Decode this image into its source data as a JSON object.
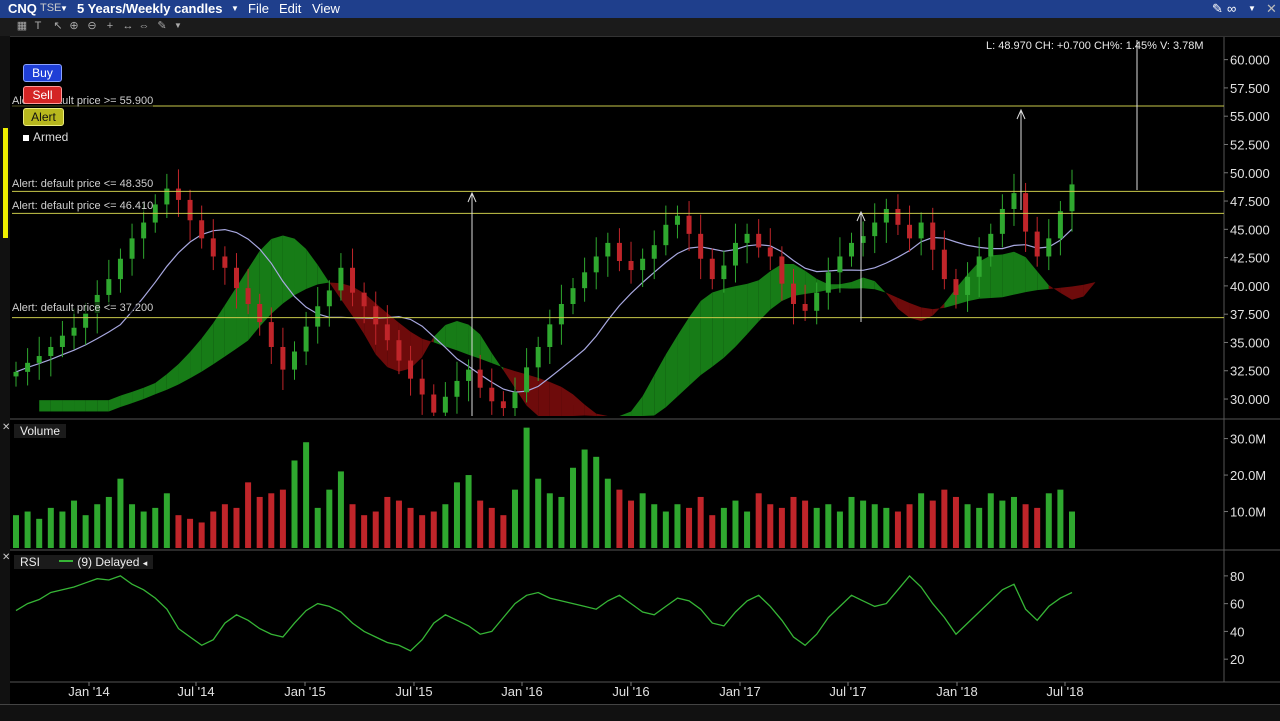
{
  "header": {
    "symbol": "CNQ",
    "exchange": "TSE",
    "period": "5 Years/Weekly candles",
    "menu": [
      "File",
      "Edit",
      "View"
    ]
  },
  "quote_readout": "L: 48.970 CH: +0.700 CH%: 1.45% V: 3.78M",
  "buttons": {
    "buy": "Buy",
    "sell": "Sell",
    "alert": "Alert",
    "armed": "Armed"
  },
  "alerts": [
    {
      "label": "Alert: default price >= 55.900",
      "price": 55.9
    },
    {
      "label": "Alert: default price <= 48.350",
      "price": 48.35
    },
    {
      "label": "Alert: default price <= 46.410",
      "price": 46.41
    },
    {
      "label": "Alert: default price <= 37.200",
      "price": 37.2
    }
  ],
  "colors": {
    "up": "#2fa82f",
    "down": "#c0252a",
    "cloud_bull": "#1a8a1a",
    "cloud_bear": "#7a0c0c",
    "ma": "#a8a8e0",
    "rsi": "#36b536",
    "alert_line": "#c8c84a",
    "title_bar": "#1f3f8c"
  },
  "panels": {
    "volume_title": "Volume",
    "rsi_title": "RSI",
    "rsi_legend": "(9) Delayed"
  },
  "chart_data": [
    {
      "type": "candlestick",
      "title": "CNQ TSE 5 Years/Weekly candles",
      "ylim": [
        28.5,
        62
      ],
      "y_ticks": [
        "60.000",
        "57.500",
        "55.000",
        "52.500",
        "50.000",
        "47.500",
        "45.000",
        "42.500",
        "40.000",
        "37.500",
        "35.000",
        "32.500",
        "30.000"
      ],
      "x_ticks": [
        "Jan '14",
        "Jul '14",
        "Jan '15",
        "Jul '15",
        "Jan '16",
        "Jul '16",
        "Jan '17",
        "Jul '17",
        "Jan '18",
        "Jul '18"
      ],
      "close_series": [
        32.4,
        33.2,
        33.8,
        34.6,
        35.6,
        36.3,
        37.6,
        39.2,
        40.6,
        42.4,
        44.2,
        45.6,
        47.2,
        48.6,
        47.6,
        45.8,
        44.2,
        42.6,
        41.6,
        39.8,
        38.4,
        36.8,
        34.6,
        32.6,
        34.2,
        36.4,
        38.2,
        39.6,
        41.6,
        39.4,
        38.2,
        36.6,
        35.2,
        33.4,
        31.8,
        30.4,
        28.8,
        30.2,
        31.6,
        32.6,
        31.0,
        29.8,
        29.2,
        30.6,
        32.8,
        34.6,
        36.6,
        38.4,
        39.8,
        41.2,
        42.6,
        43.8,
        42.2,
        41.4,
        42.4,
        43.6,
        45.4,
        46.2,
        44.6,
        42.4,
        40.6,
        41.8,
        43.8,
        44.6,
        43.4,
        42.6,
        40.2,
        38.4,
        37.8,
        39.4,
        41.2,
        42.6,
        43.8,
        44.4,
        45.6,
        46.8,
        45.4,
        44.2,
        45.6,
        43.2,
        40.6,
        39.2,
        40.8,
        42.6,
        44.6,
        46.8,
        48.2,
        44.8,
        42.6,
        44.2,
        46.6,
        48.97
      ],
      "alert_levels": [
        55.9,
        48.35,
        46.41,
        37.2
      ]
    },
    {
      "type": "bar",
      "title": "Volume",
      "y_ticks": [
        "30.0M",
        "20.0M",
        "10.0M"
      ],
      "ylim": [
        0,
        34
      ],
      "values": [
        9,
        10,
        8,
        11,
        10,
        13,
        9,
        12,
        14,
        19,
        12,
        10,
        11,
        15,
        9,
        8,
        7,
        10,
        12,
        11,
        18,
        14,
        15,
        16,
        24,
        29,
        11,
        16,
        21,
        12,
        9,
        10,
        14,
        13,
        11,
        9,
        10,
        12,
        18,
        20,
        13,
        11,
        9,
        16,
        33,
        19,
        15,
        14,
        22,
        27,
        25,
        19,
        16,
        13,
        15,
        12,
        10,
        12,
        11,
        14,
        9,
        11,
        13,
        10,
        15,
        12,
        11,
        14,
        13,
        11,
        12,
        10,
        14,
        13,
        12,
        11,
        10,
        12,
        15,
        13,
        16,
        14,
        12,
        11,
        15,
        13,
        14,
        12,
        11,
        15,
        16,
        10
      ]
    },
    {
      "type": "line",
      "title": "RSI",
      "y_ticks": [
        "80",
        "60",
        "40",
        "20"
      ],
      "ylim": [
        5,
        90
      ],
      "values": [
        55,
        60,
        63,
        68,
        70,
        72,
        75,
        78,
        77,
        80,
        74,
        70,
        64,
        56,
        42,
        36,
        30,
        34,
        46,
        52,
        48,
        42,
        38,
        36,
        46,
        55,
        60,
        58,
        54,
        46,
        40,
        36,
        32,
        30,
        26,
        34,
        46,
        52,
        48,
        44,
        38,
        40,
        50,
        60,
        66,
        68,
        64,
        62,
        60,
        58,
        56,
        62,
        66,
        60,
        54,
        52,
        58,
        64,
        62,
        56,
        46,
        44,
        54,
        62,
        66,
        58,
        48,
        36,
        30,
        38,
        50,
        58,
        66,
        62,
        58,
        60,
        70,
        80,
        72,
        60,
        50,
        38,
        46,
        54,
        62,
        70,
        74,
        56,
        48,
        58,
        64,
        68
      ]
    }
  ]
}
